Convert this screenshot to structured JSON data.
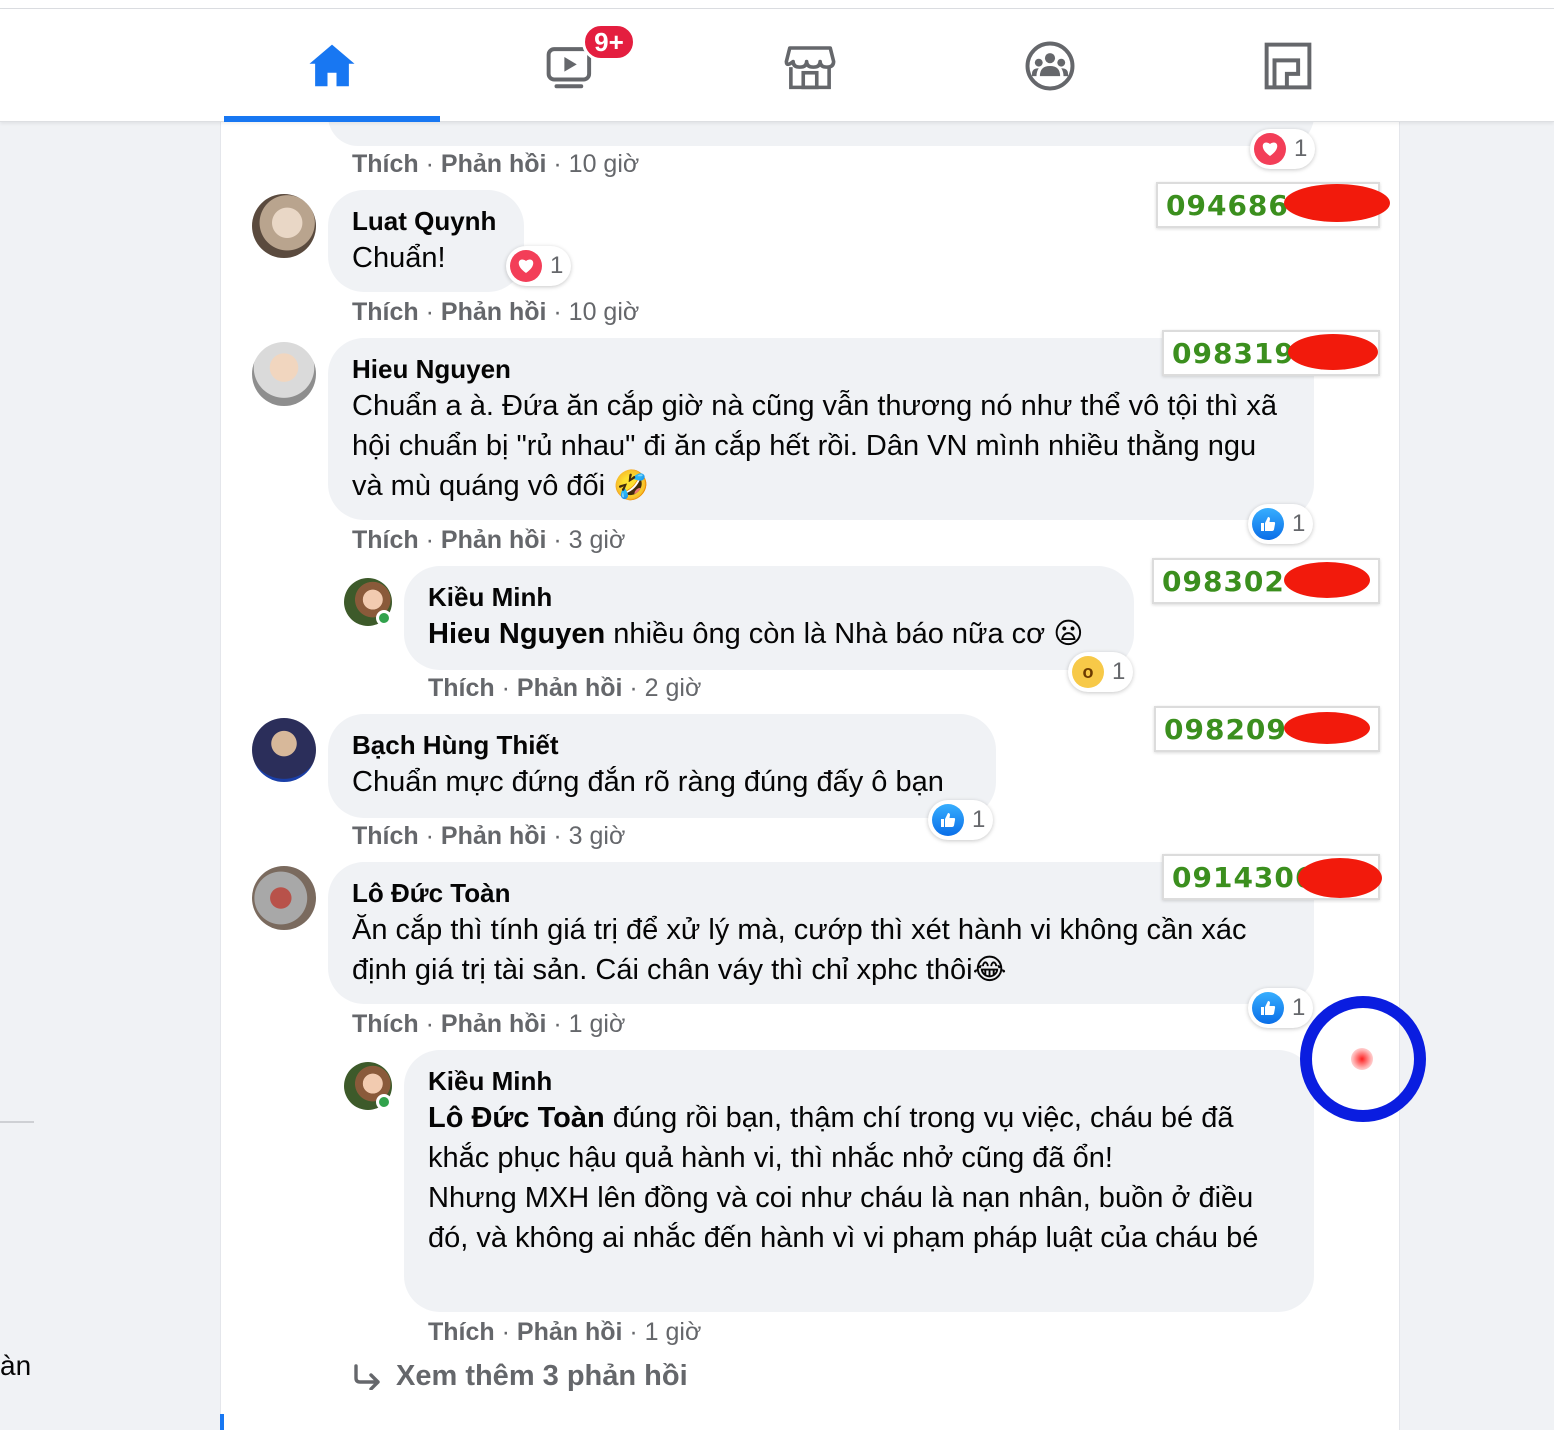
{
  "nav": {
    "tabs": [
      {
        "name": "home",
        "icon": "home-icon",
        "active": true
      },
      {
        "name": "watch",
        "icon": "video-play-icon",
        "badge": "9+"
      },
      {
        "name": "marketplace",
        "icon": "store-icon"
      },
      {
        "name": "groups",
        "icon": "groups-icon"
      },
      {
        "name": "gaming",
        "icon": "gaming-icon"
      }
    ]
  },
  "left_sidebar": {
    "fragment": "àn"
  },
  "colors": {
    "accent": "#1877f2",
    "badge": "#e41e3f",
    "phone_text": "#3b8f1e",
    "redaction": "#f21a0c",
    "cursor_ring": "#0a1de0"
  },
  "top_partial": {
    "like": "Thích",
    "reply": "Phản hồi",
    "time": "10 giờ",
    "reaction_count": "1",
    "reaction_icon": "heart-icon"
  },
  "comments": [
    {
      "author": "Luat Quynh",
      "text": "Chuẩn!",
      "like": "Thích",
      "reply": "Phản hồi",
      "time": "10 giờ",
      "reaction_count": "1",
      "reaction_icon": "heart-icon",
      "phone": "094686"
    },
    {
      "author": "Hieu Nguyen",
      "text": "Chuẩn a à. Đứa ăn cắp giờ nà cũng vẫn thương nó như thể vô tội thì xã hội chuẩn bị \"rủ nhau\" đi ăn cắp hết rồi. Dân VN mình nhiều thằng ngu và mù quáng vô đối 🤣",
      "like": "Thích",
      "reply": "Phản hồi",
      "time": "3 giờ",
      "reaction_count": "1",
      "reaction_icon": "like-icon",
      "phone": "098319"
    },
    {
      "author": "Kiều Minh",
      "mention": "Hieu Nguyen",
      "text": " nhiều ông còn là Nhà báo nữa cơ 😦",
      "like": "Thích",
      "reply": "Phản hồi",
      "time": "2 giờ",
      "reaction_count": "1",
      "reaction_icon": "wow-icon",
      "phone": "098302"
    },
    {
      "author": "Bạch Hùng Thiết",
      "text": "Chuẩn mực đứng đắn rõ ràng đúng đấy ô bạn",
      "like": "Thích",
      "reply": "Phản hồi",
      "time": "3 giờ",
      "reaction_count": "1",
      "reaction_icon": "like-icon",
      "phone": "098209"
    },
    {
      "author": "Lô Đức Toàn",
      "text": "Ăn cắp thì tính giá trị để xử lý mà, cướp thì xét hành vi không cần xác định giá trị tài sản. Cái chân váy thì chỉ xphc thôi😂",
      "like": "Thích",
      "reply": "Phản hồi",
      "time": "1 giờ",
      "reaction_count": "1",
      "reaction_icon": "like-icon",
      "phone": "0914306"
    },
    {
      "author": "Kiều Minh",
      "mention": "Lô Đức Toàn",
      "text": " đúng rồi bạn, thậm chí trong vụ việc, cháu bé đã khắc phục hậu quả hành vi, thì nhắc nhở cũng đã ổn!",
      "text2": "Nhưng MXH lên đồng và coi như cháu là nạn nhân, buồn ở điều đó, và không ai nhắc đến hành vì vi phạm pháp luật của cháu bé",
      "like": "Thích",
      "reply": "Phản hồi",
      "time": "1 giờ"
    }
  ],
  "more_replies": "Xem thêm 3 phản hồi"
}
